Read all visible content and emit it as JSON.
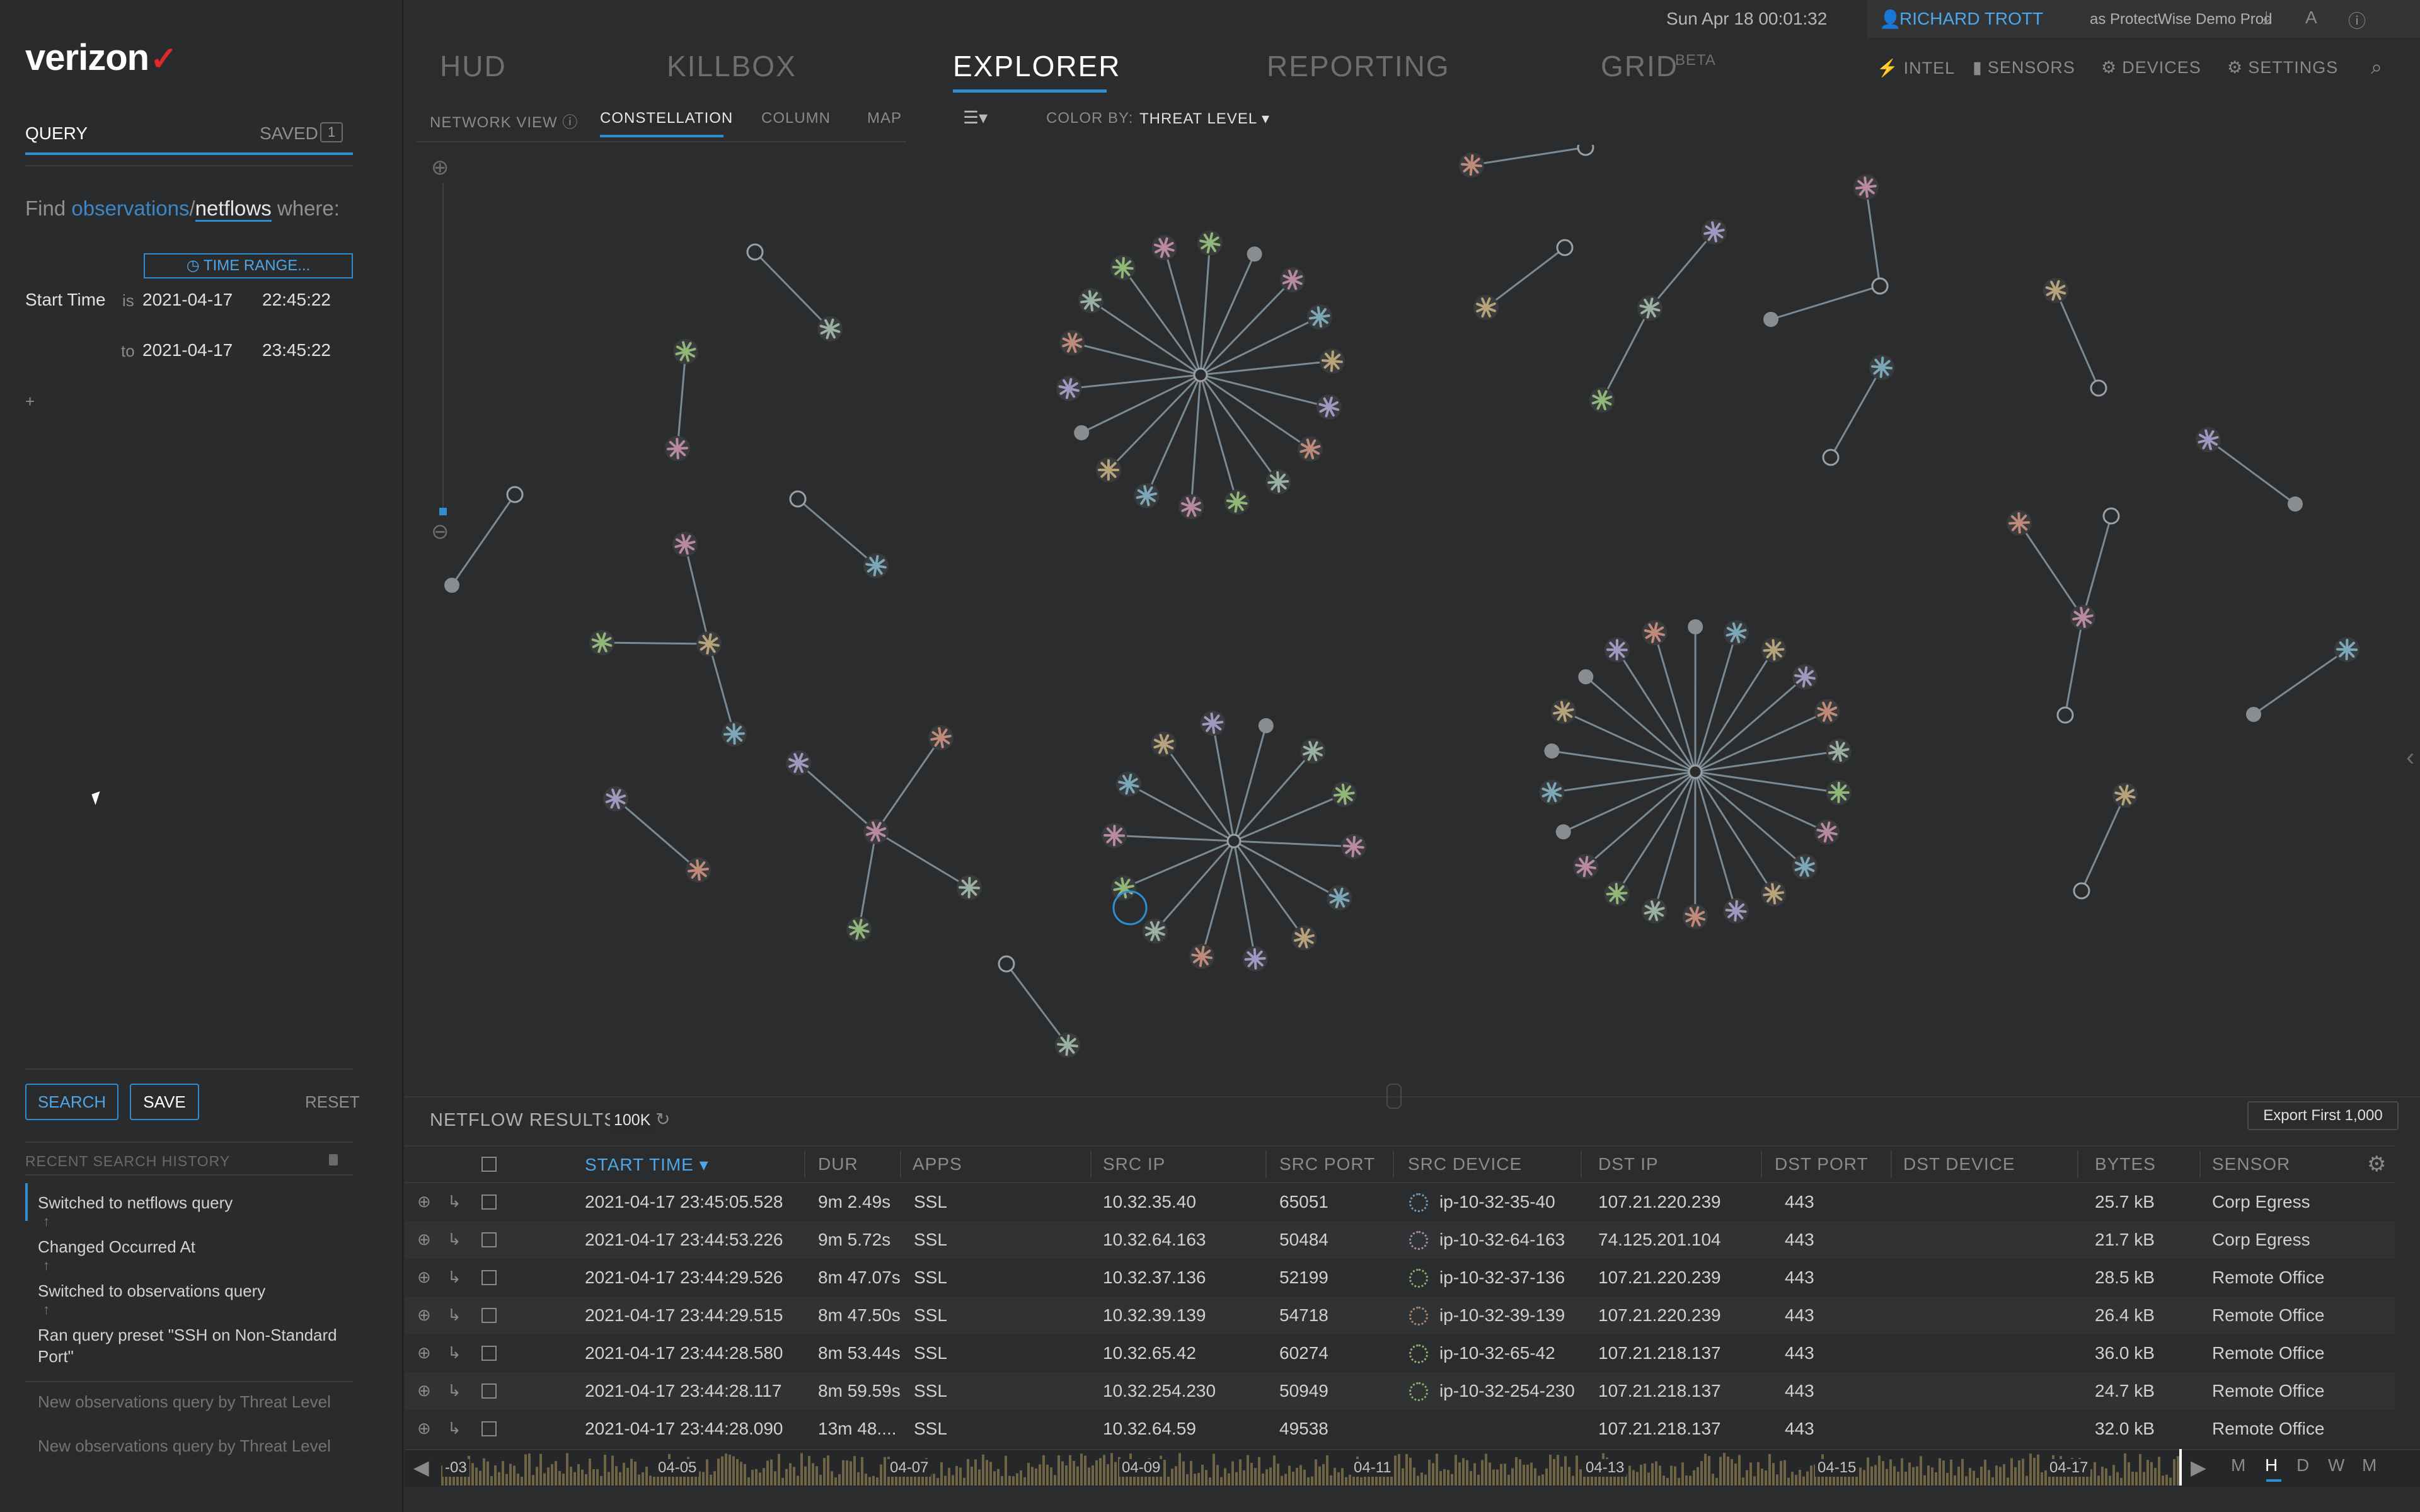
{
  "brand": {
    "name": "verizon",
    "check": "✓"
  },
  "header": {
    "datetime": "Sun Apr 18 00:01:32",
    "user": "RICHARD TROTT",
    "as_org": "as ProtectWise Demo Prod",
    "nav": [
      "HUD",
      "KILLBOX",
      "EXPLORER",
      "REPORTING",
      "GRID"
    ],
    "nav_beta": "BETA",
    "subnav": [
      "INTEL",
      "SENSORS",
      "DEVICES",
      "SETTINGS"
    ]
  },
  "query": {
    "tab_query": "QUERY",
    "tab_saved": "SAVED",
    "saved_count": "1",
    "find_prefix": "Find",
    "opt1": "observations",
    "slash": "/",
    "opt2": "netflows",
    "where": "where:",
    "time_range_btn": "TIME RANGE...",
    "start_label": "Start Time",
    "is_label": "is",
    "to_label": "to",
    "from_date": "2021-04-17",
    "from_time": "22:45:22",
    "to_date": "2021-04-17",
    "to_time": "23:45:22",
    "plus": "+",
    "search": "SEARCH",
    "save": "SAVE",
    "reset": "RESET"
  },
  "history": {
    "title": "RECENT SEARCH HISTORY",
    "items": [
      "Switched to netflows query",
      "Changed Occurred At",
      "Switched to observations query",
      "Ran query preset \"SSH on Non-Standard Port\"",
      "New observations query by Threat Level",
      "New observations query by Threat Level"
    ]
  },
  "view": {
    "network_view": "NETWORK VIEW",
    "tabs": [
      "CONSTELLATION",
      "COLUMN",
      "MAP"
    ],
    "color_by_label": "COLOR BY:",
    "color_by_value": "THREAT LEVEL"
  },
  "results": {
    "title": "NETFLOW RESULTS",
    "count": "100K",
    "export": "Export First 1,000",
    "columns": [
      "START TIME",
      "DUR",
      "APPS",
      "SRC IP",
      "SRC PORT",
      "SRC DEVICE",
      "DST IP",
      "DST PORT",
      "DST DEVICE",
      "BYTES",
      "SENSOR"
    ],
    "rows": [
      [
        "2021-04-17 23:45:05.528",
        "9m 2.49s",
        "SSL",
        "10.32.35.40",
        "65051",
        "ip-10-32-35-40",
        "107.21.220.239",
        "443",
        "",
        "25.7 kB",
        "Corp Egress"
      ],
      [
        "2021-04-17 23:44:53.226",
        "9m 5.72s",
        "SSL",
        "10.32.64.163",
        "50484",
        "ip-10-32-64-163",
        "74.125.201.104",
        "443",
        "",
        "21.7 kB",
        "Corp Egress"
      ],
      [
        "2021-04-17 23:44:29.526",
        "8m 47.07s",
        "SSL",
        "10.32.37.136",
        "52199",
        "ip-10-32-37-136",
        "107.21.220.239",
        "443",
        "",
        "28.5 kB",
        "Remote Office"
      ],
      [
        "2021-04-17 23:44:29.515",
        "8m 47.50s",
        "SSL",
        "10.32.39.139",
        "54718",
        "ip-10-32-39-139",
        "107.21.220.239",
        "443",
        "",
        "26.4 kB",
        "Remote Office"
      ],
      [
        "2021-04-17 23:44:28.580",
        "8m 53.44s",
        "SSL",
        "10.32.65.42",
        "60274",
        "ip-10-32-65-42",
        "107.21.218.137",
        "443",
        "",
        "36.0 kB",
        "Remote Office"
      ],
      [
        "2021-04-17 23:44:28.117",
        "8m 59.59s",
        "SSL",
        "10.32.254.230",
        "50949",
        "ip-10-32-254-230",
        "107.21.218.137",
        "443",
        "",
        "24.7 kB",
        "Remote Office"
      ],
      [
        "2021-04-17 23:44:28.090",
        "13m 48....",
        "SSL",
        "10.32.64.59",
        "49538",
        "",
        "107.21.218.137",
        "443",
        "",
        "32.0 kB",
        "Remote Office"
      ]
    ]
  },
  "timeline": {
    "labels": [
      "-03",
      "04-05",
      "04-07",
      "04-09",
      "04-11",
      "04-13",
      "04-15",
      "04-17"
    ],
    "scales": [
      "M",
      "H",
      "D",
      "W",
      "M"
    ]
  },
  "colors": {
    "accent": "#2f8ed2",
    "brand_check": "#e0292f",
    "background": "#2b2c2e"
  }
}
